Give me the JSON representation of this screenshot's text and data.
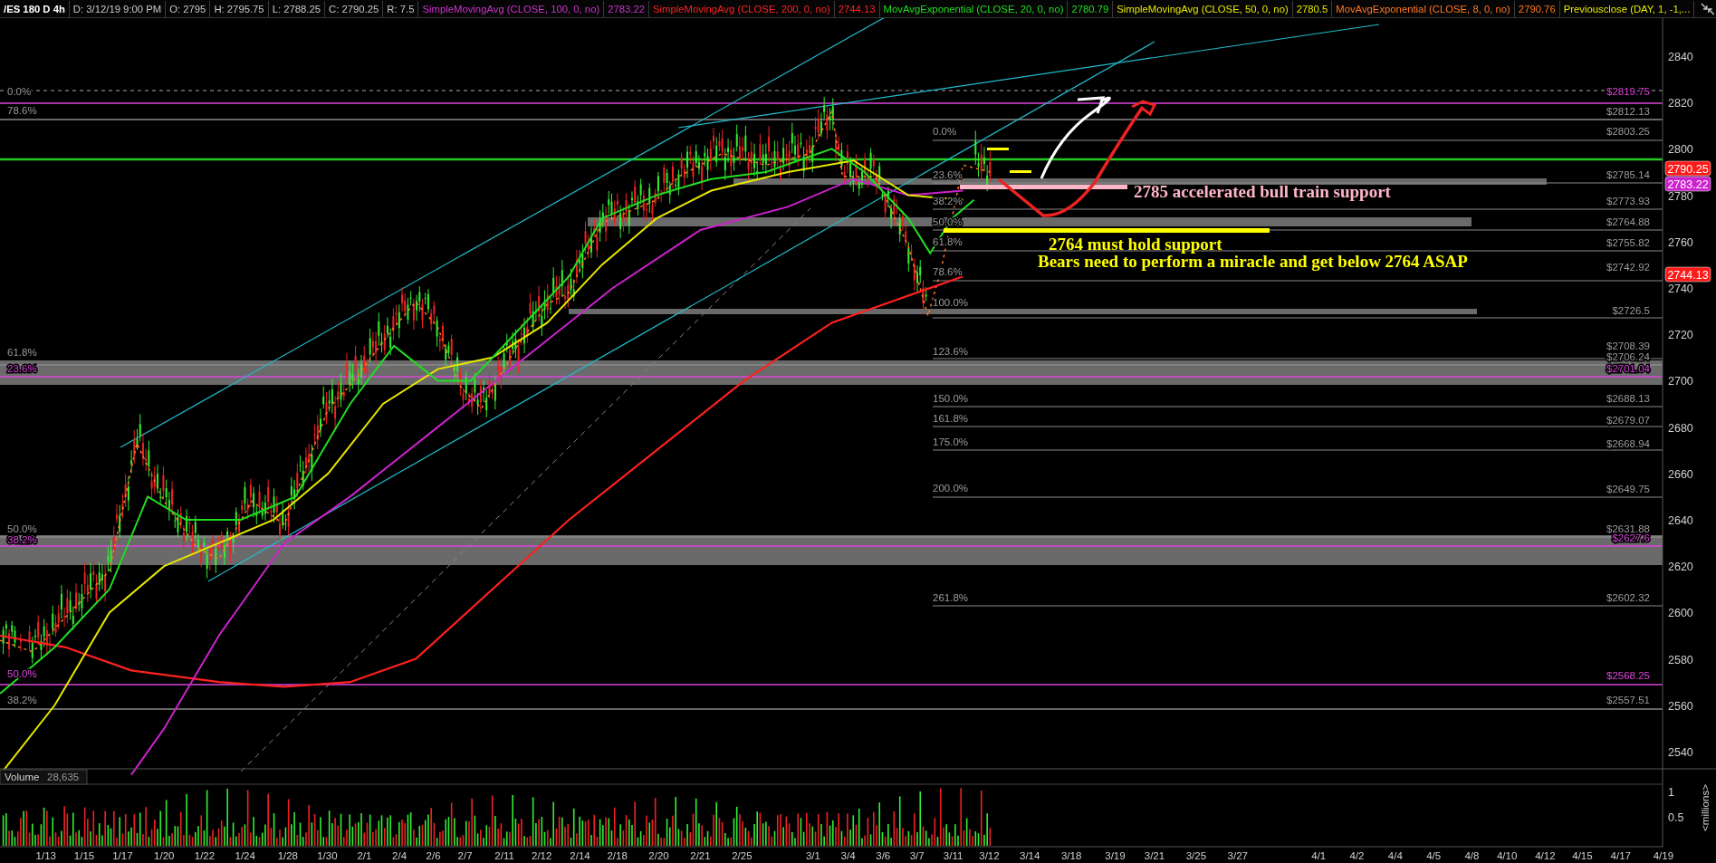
{
  "header": {
    "symbol": "/ES 180 D 4h",
    "fields": [
      "D: 3/12/19 9:00 PM",
      "O: 2795",
      "H: 2795.75",
      "L: 2788.25",
      "C: 2790.25",
      "R: 7.5"
    ],
    "studies": [
      {
        "name": "SimpleMovingAvg (CLOSE, 100, 0, no)",
        "value": "2783.22",
        "color": "#cc33cc"
      },
      {
        "name": "SimpleMovingAvg (CLOSE, 200, 0, no)",
        "value": "2744.13",
        "color": "#ff2222"
      },
      {
        "name": "MovAvgExponential (CLOSE, 20, 0, no)",
        "value": "2780.79",
        "color": "#22dd22"
      },
      {
        "name": "SimpleMovingAvg (CLOSE, 50, 0, no)",
        "value": "2780.5",
        "color": "#e6e600"
      },
      {
        "name": "MovAvgExponential (CLOSE, 8, 0, no)",
        "value": "2790.76",
        "color": "#ff7722"
      },
      {
        "name": "Previousclose (DAY, 1, -1,...",
        "color": "#e6e600"
      }
    ]
  },
  "chart": {
    "price_axis": [
      "2840",
      "2820",
      "2800",
      "2780",
      "2760",
      "2740",
      "2720",
      "2700",
      "2680",
      "2660",
      "2640",
      "2620",
      "2600",
      "2580",
      "2560",
      "2540"
    ],
    "price_tags": [
      {
        "text": "2790.25",
        "color": "#ff1a1a"
      },
      {
        "text": "2783.22",
        "color": "#cc22cc"
      },
      {
        "text": "2744.13",
        "color": "#ff1a1a"
      }
    ],
    "left_labels": [
      {
        "text": "0.0%",
        "color": "#9a9a9a"
      },
      {
        "text": "78.6%",
        "color": "#9a9a9a"
      },
      {
        "text": "61.8%",
        "color": "#9a9a9a"
      },
      {
        "text": "23.6%",
        "color": "#dd44dd"
      },
      {
        "text": "50.0%",
        "color": "#9a9a9a"
      },
      {
        "text": "38.2%",
        "color": "#dd44dd"
      },
      {
        "text": "50.0%",
        "color": "#dd44dd"
      },
      {
        "text": "38.2%",
        "color": "#9a9a9a"
      }
    ],
    "fib_labels": [
      "0.0%",
      "23.6%",
      "38.2%",
      "50.0%",
      "61.8%",
      "78.6%",
      "100.0%",
      "123.6%",
      "150.0%",
      "161.8%",
      "175.0%",
      "200.0%",
      "261.8%"
    ],
    "price_labels": [
      {
        "text": "$2819.75",
        "color": "#dd44dd"
      },
      {
        "text": "$2812.13",
        "color": "#9a9a9a"
      },
      {
        "text": "$2803.25",
        "color": "#9a9a9a"
      },
      {
        "text": "$2785.14",
        "color": "#9a9a9a"
      },
      {
        "text": "$2773.93",
        "color": "#9a9a9a"
      },
      {
        "text": "$2764.88",
        "color": "#9a9a9a"
      },
      {
        "text": "$2755.82",
        "color": "#9a9a9a"
      },
      {
        "text": "$2742.92",
        "color": "#9a9a9a"
      },
      {
        "text": "$2726.5",
        "color": "#9a9a9a"
      },
      {
        "text": "$2708.39",
        "color": "#9a9a9a"
      },
      {
        "text": "$2706.24",
        "color": "#9a9a9a"
      },
      {
        "text": "$2701.04",
        "color": "#dd44dd"
      },
      {
        "text": "$2688.13",
        "color": "#9a9a9a"
      },
      {
        "text": "$2679.07",
        "color": "#9a9a9a"
      },
      {
        "text": "$2668.94",
        "color": "#9a9a9a"
      },
      {
        "text": "$2649.75",
        "color": "#9a9a9a"
      },
      {
        "text": "$2631.88",
        "color": "#9a9a9a"
      },
      {
        "text": "$2627.6",
        "color": "#dd44dd"
      },
      {
        "text": "$2602.32",
        "color": "#9a9a9a"
      },
      {
        "text": "$2568.25",
        "color": "#dd44dd"
      },
      {
        "text": "$2557.51",
        "color": "#9a9a9a"
      }
    ],
    "annotations": [
      {
        "text": "2785 accelerated bull train support",
        "color": "#ffb6c8"
      },
      {
        "text": "2764 must hold support",
        "color": "#ffff00"
      },
      {
        "text": "Bears need to perform a miracle and get below 2764 ASAP",
        "color": "#ffff00"
      }
    ],
    "date_axis": [
      "1/13",
      "1/15",
      "1/17",
      "1/20",
      "1/22",
      "1/24",
      "1/28",
      "1/30",
      "2/1",
      "2/4",
      "2/6",
      "2/7",
      "2/11",
      "2/12",
      "2/14",
      "2/18",
      "2/20",
      "2/21",
      "2/25",
      "3/1",
      "3/4",
      "3/6",
      "3/7",
      "3/11",
      "3/12",
      "3/14",
      "3/18",
      "3/19",
      "3/21",
      "3/25",
      "3/27",
      "4/1",
      "4/2",
      "4/4",
      "4/5",
      "4/8",
      "4/10",
      "4/12",
      "4/15",
      "4/17",
      "4/19"
    ]
  },
  "volume": {
    "title": "Volume",
    "value": "28,635",
    "axis": [
      "1",
      "0.5"
    ],
    "unit": "<millions>"
  }
}
